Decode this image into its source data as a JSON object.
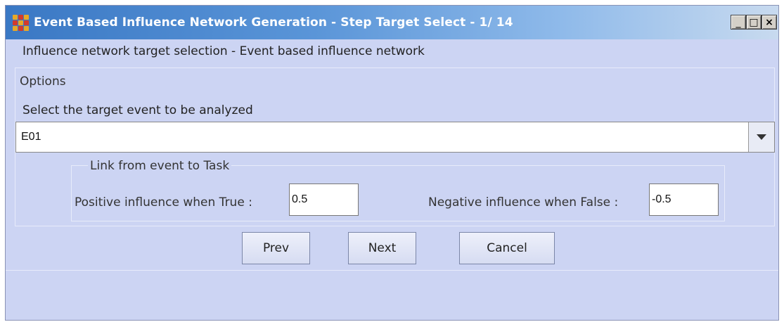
{
  "window": {
    "title": "Event Based Influence Network Generation - Step Target Select - 1/ 14",
    "controls": {
      "minimize": "_",
      "maximize": "□",
      "close": "×"
    }
  },
  "subtitle": "Influence network target selection - Event based influence network",
  "options": {
    "group_label": "Options",
    "select_label": "Select the target event to be analyzed",
    "selected_event": "E01"
  },
  "link": {
    "group_label": "Link from event to Task",
    "positive_label": "Positive influence when True :",
    "positive_value": "0.5",
    "negative_label": "Negative influence when False :",
    "negative_value": "-0.5"
  },
  "buttons": {
    "prev": "Prev",
    "next": "Next",
    "cancel": "Cancel"
  },
  "colors": {
    "window_bg": "#ccd4f3",
    "title_start": "#3a78c4",
    "title_end": "#c8daef"
  }
}
